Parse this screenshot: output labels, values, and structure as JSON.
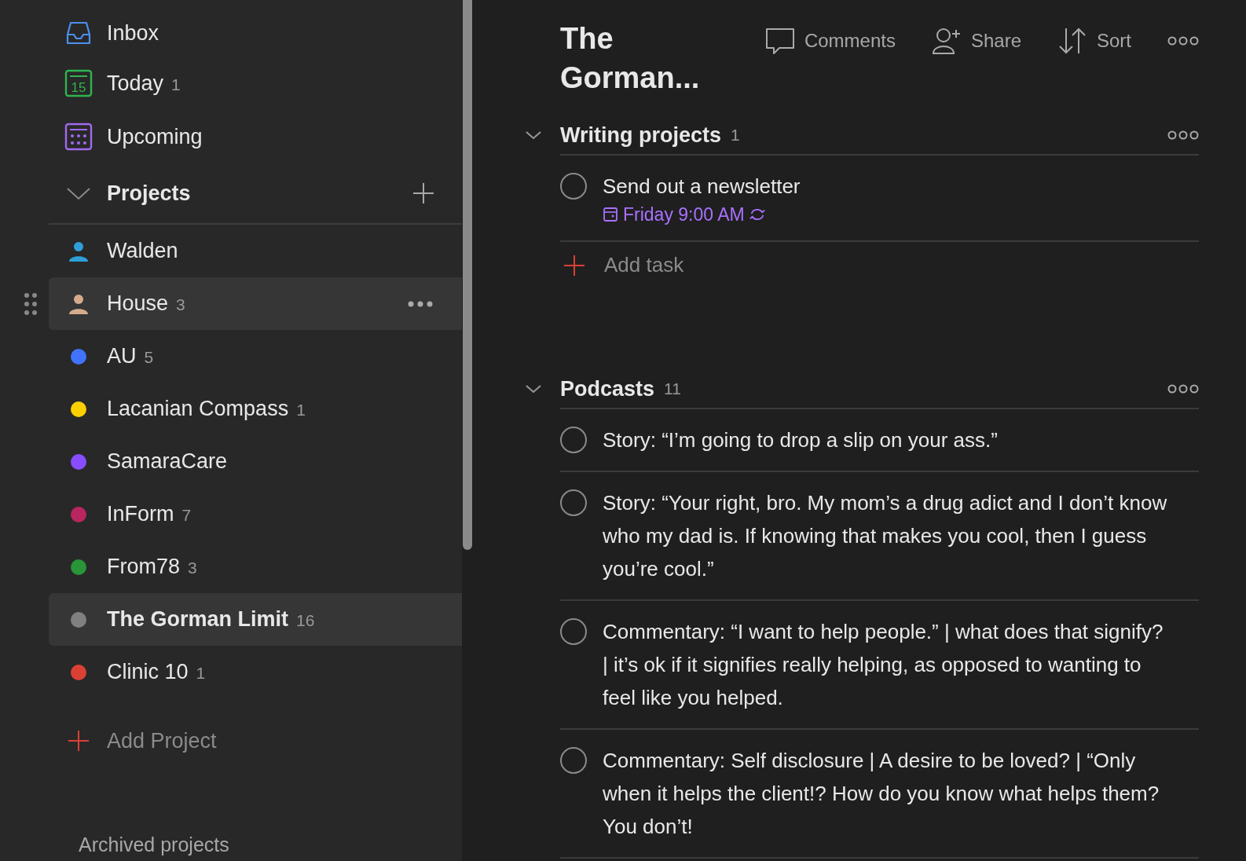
{
  "sidebar": {
    "nav": [
      {
        "kind": "inbox",
        "label": "Inbox"
      },
      {
        "kind": "today",
        "label": "Today",
        "count": "1",
        "icon_text": "15"
      },
      {
        "kind": "upcoming",
        "label": "Upcoming"
      }
    ],
    "projects_header": {
      "label": "Projects",
      "expanded": true
    },
    "projects": [
      {
        "kind": "person",
        "label": "Walden",
        "color": "#2f9fd8",
        "selected": false,
        "hovered": false
      },
      {
        "kind": "person",
        "label": "House",
        "count": "3",
        "color": "#d4ab8c",
        "selected": false,
        "hovered": true
      },
      {
        "kind": "dot",
        "label": "AU",
        "count": "5",
        "color": "#4073ff",
        "selected": false,
        "hovered": false
      },
      {
        "kind": "dot",
        "label": "Lacanian Compass",
        "count": "1",
        "color": "#fad000",
        "selected": false,
        "hovered": false
      },
      {
        "kind": "dot",
        "label": "SamaraCare",
        "color": "#884dff",
        "selected": false,
        "hovered": false
      },
      {
        "kind": "dot",
        "label": "InForm",
        "count": "7",
        "color": "#b8255f",
        "selected": false,
        "hovered": false
      },
      {
        "kind": "dot",
        "label": "From78",
        "count": "3",
        "color": "#299438",
        "selected": false,
        "hovered": false
      },
      {
        "kind": "dot",
        "label": "The Gorman Limit",
        "count": "16",
        "color": "#808080",
        "selected": true,
        "hovered": false
      },
      {
        "kind": "dot",
        "label": "Clinic 10",
        "count": "1",
        "color": "#db4035",
        "selected": false,
        "hovered": false
      }
    ],
    "add_project": "Add Project",
    "archived": "Archived projects"
  },
  "main": {
    "title": "The Gorman...",
    "toolbar": [
      {
        "kind": "comments",
        "label": "Comments"
      },
      {
        "kind": "share",
        "label": "Share"
      },
      {
        "kind": "sort",
        "label": "Sort"
      },
      {
        "kind": "more"
      }
    ],
    "sections": [
      {
        "title": "Writing projects",
        "count": "1",
        "expanded": true,
        "add_task": "Add task",
        "tasks": [
          {
            "text": "Send out a newsletter",
            "checked": false,
            "due": "Friday 9:00 AM",
            "recurring": true
          }
        ]
      },
      {
        "title": "Podcasts",
        "count": "11",
        "expanded": true,
        "tasks": [
          {
            "text": "Story: “I’m going to drop a slip on your ass.”",
            "checked": false
          },
          {
            "text": "Story: “Your right, bro. My mom’s a drug adict and I don’t know who my dad is. If knowing that makes you cool, then I guess you’re cool.”",
            "checked": false
          },
          {
            "text": "Commentary: “I want to help people.” | what does that signify? | it’s ok if it signifies really helping, as opposed to wanting to feel like you helped.",
            "checked": false
          },
          {
            "text": "Commentary: Self disclosure | A desire to be loved? | “Only when it helps the client!? How do you know what helps them? You don’t!",
            "checked": false
          }
        ]
      }
    ]
  }
}
